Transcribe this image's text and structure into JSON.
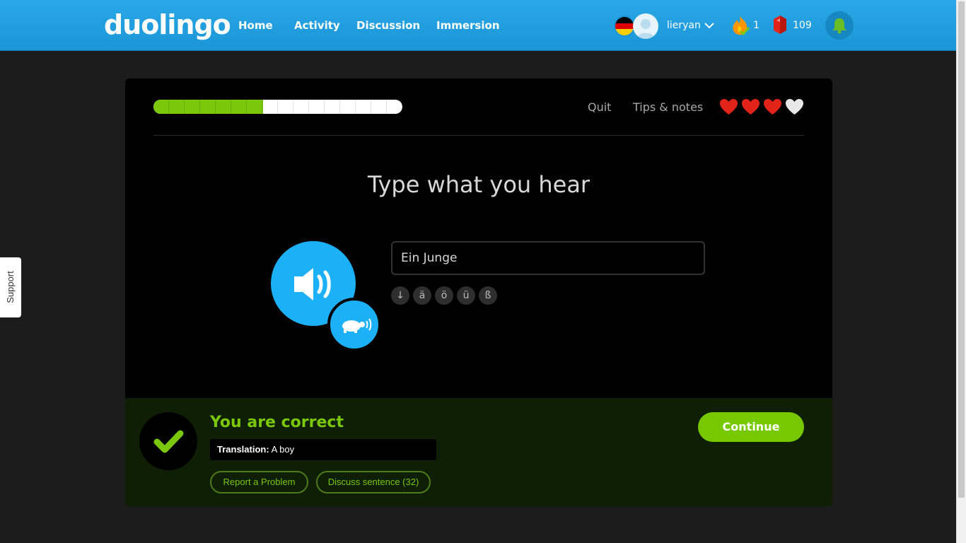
{
  "header": {
    "logo": "duolingo",
    "nav": [
      "Home",
      "Activity",
      "Discussion",
      "Immersion"
    ],
    "username": "lieryan",
    "streak": "1",
    "lingots": "109"
  },
  "support_tab": "Support",
  "lesson": {
    "progress_fraction": 0.44,
    "quit_label": "Quit",
    "tips_label": "Tips & notes",
    "hearts_total": 4,
    "hearts_remaining": 3,
    "prompt": "Type what you hear",
    "answer_value": "Ein Junge",
    "special_chars": [
      "↓",
      "ä",
      "ö",
      "ü",
      "ß"
    ]
  },
  "result": {
    "heading": "You are correct",
    "translation_label": "Translation:",
    "translation_text": "A boy",
    "report_button": "Report a Problem",
    "discuss_button": "Discuss sentence (32)",
    "continue_button": "Continue"
  },
  "colors": {
    "header_blue": "#1cb0f6",
    "success_green": "#7ac70c",
    "heart_red": "#e2231a"
  }
}
